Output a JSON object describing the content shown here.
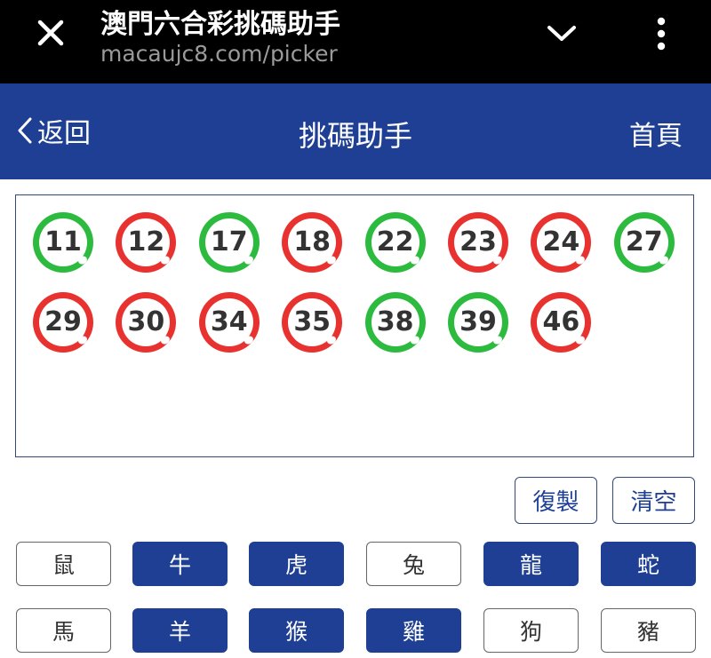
{
  "browser": {
    "title": "澳門六合彩挑碼助手",
    "url": "macaujc8.com/picker",
    "icons": {
      "close": "close-icon",
      "dropdown": "chevron-down-icon",
      "menu": "more-vertical-icon"
    }
  },
  "header": {
    "back_label": "返回",
    "title": "挑碼助手",
    "home_label": "首頁",
    "background": "#1e3f94"
  },
  "selected_numbers": [
    {
      "num": "11",
      "color": "green"
    },
    {
      "num": "12",
      "color": "red"
    },
    {
      "num": "17",
      "color": "green"
    },
    {
      "num": "18",
      "color": "red"
    },
    {
      "num": "22",
      "color": "green"
    },
    {
      "num": "23",
      "color": "red"
    },
    {
      "num": "24",
      "color": "red"
    },
    {
      "num": "27",
      "color": "green"
    },
    {
      "num": "29",
      "color": "red"
    },
    {
      "num": "30",
      "color": "red"
    },
    {
      "num": "34",
      "color": "red"
    },
    {
      "num": "35",
      "color": "red"
    },
    {
      "num": "38",
      "color": "green"
    },
    {
      "num": "39",
      "color": "green"
    },
    {
      "num": "46",
      "color": "red"
    }
  ],
  "actions": {
    "copy_label": "復製",
    "clear_label": "清空"
  },
  "zodiac": [
    {
      "label": "鼠",
      "selected": false
    },
    {
      "label": "牛",
      "selected": true
    },
    {
      "label": "虎",
      "selected": true
    },
    {
      "label": "兔",
      "selected": false
    },
    {
      "label": "龍",
      "selected": true
    },
    {
      "label": "蛇",
      "selected": true
    },
    {
      "label": "馬",
      "selected": false
    },
    {
      "label": "羊",
      "selected": true
    },
    {
      "label": "猴",
      "selected": true
    },
    {
      "label": "雞",
      "selected": true
    },
    {
      "label": "狗",
      "selected": false
    },
    {
      "label": "豬",
      "selected": false
    }
  ],
  "colors": {
    "red": "#e8322f",
    "green": "#2dbb3f",
    "accent": "#1e3f94"
  }
}
